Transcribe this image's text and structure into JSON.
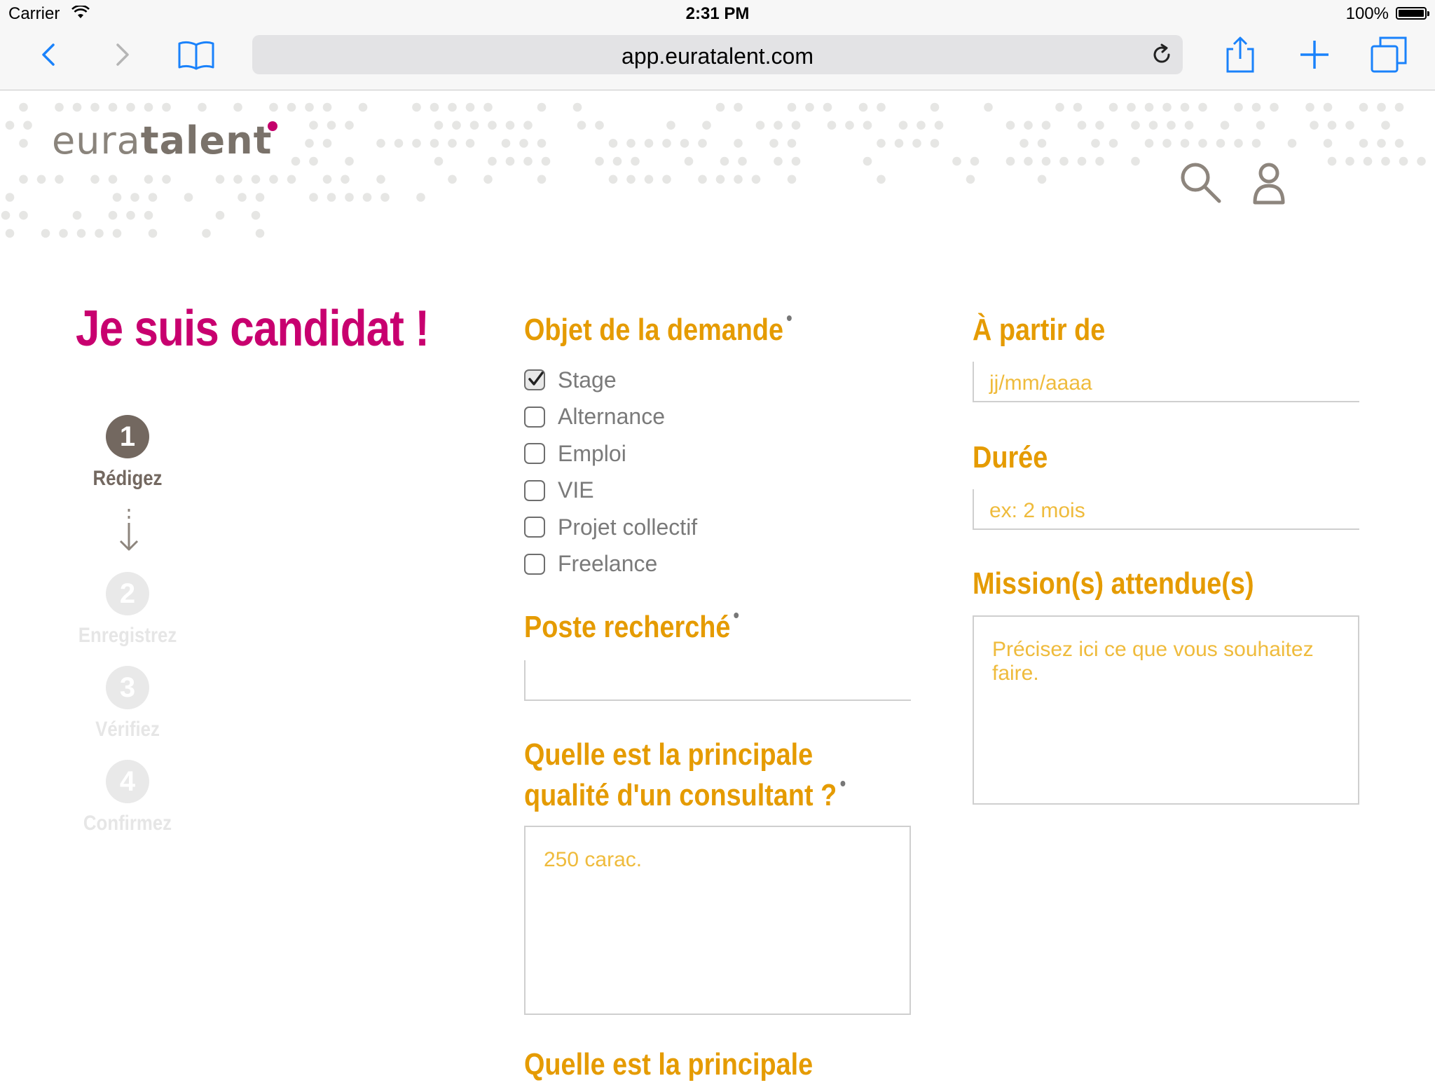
{
  "status_bar": {
    "carrier": "Carrier",
    "time": "2:31 PM",
    "battery": "100%"
  },
  "browser": {
    "url": "app.euratalent.com",
    "accent_color": "#1a82fb"
  },
  "header": {
    "logo_part1": "eura",
    "logo_part2": "talent",
    "brand_color": "#c4006b"
  },
  "page": {
    "title": "Je suis candidat !"
  },
  "steps": [
    {
      "number": "1",
      "label": "Rédigez",
      "active": true
    },
    {
      "number": "2",
      "label": "Enregistrez",
      "active": false
    },
    {
      "number": "3",
      "label": "Vérifiez",
      "active": false
    },
    {
      "number": "4",
      "label": "Confirmez",
      "active": false
    }
  ],
  "form": {
    "objet": {
      "label": "Objet de la demande",
      "options": [
        {
          "label": "Stage",
          "checked": true
        },
        {
          "label": "Alternance",
          "checked": false
        },
        {
          "label": "Emploi",
          "checked": false
        },
        {
          "label": "VIE",
          "checked": false
        },
        {
          "label": "Projet collectif",
          "checked": false
        },
        {
          "label": "Freelance",
          "checked": false
        }
      ]
    },
    "poste": {
      "label": "Poste recherché",
      "value": ""
    },
    "qualite": {
      "label_line1": "Quelle est la principale",
      "label_line2": "qualité d'un consultant ?",
      "placeholder": "250 carac."
    },
    "next_question_partial": "Quelle est la principale",
    "a_partir_de": {
      "label": "À partir de",
      "placeholder": "jj/mm/aaaa"
    },
    "duree": {
      "label": "Durée",
      "placeholder": "ex: 2 mois"
    },
    "missions": {
      "label": "Mission(s) attendue(s)",
      "placeholder": "Précisez ici ce que vous souhaitez faire."
    }
  },
  "colors": {
    "label_orange": "#e59b00",
    "placeholder_orange": "#efbb3c",
    "title_magenta": "#c8006f",
    "step_active": "#736860"
  }
}
